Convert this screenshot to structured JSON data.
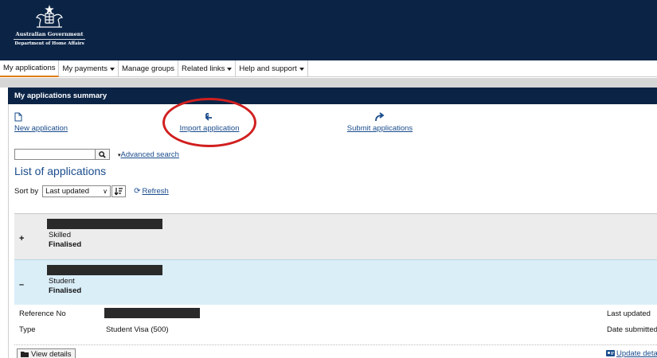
{
  "header": {
    "org_line1": "Australian Government",
    "org_line2": "Department of Home Affairs"
  },
  "nav": {
    "items": [
      {
        "label": "My applications",
        "active": true,
        "dropdown": false
      },
      {
        "label": "My payments",
        "active": false,
        "dropdown": true
      },
      {
        "label": "Manage groups",
        "active": false,
        "dropdown": false
      },
      {
        "label": "Related links",
        "active": false,
        "dropdown": true
      },
      {
        "label": "Help and support",
        "active": false,
        "dropdown": true
      }
    ]
  },
  "summary": {
    "title": "My applications summary",
    "actions": {
      "new": {
        "label": "New application",
        "icon": "document-icon"
      },
      "import": {
        "label": "Import application",
        "icon": "import-arrow-icon"
      },
      "submit": {
        "label": "Submit applications",
        "icon": "share-arrow-icon"
      }
    },
    "highlight_color": "#d11f1f"
  },
  "search": {
    "value": "",
    "button_icon": "search-icon",
    "advanced_label": "Advanced search"
  },
  "list": {
    "title": "List of applications",
    "sort_label": "Sort by",
    "sort_value": "Last updated",
    "refresh_label": "Refresh",
    "applications": [
      {
        "toggle": "+",
        "type": "Skilled",
        "status": "Finalised",
        "expanded": false
      },
      {
        "toggle": "–",
        "type": "Student",
        "status": "Finalised",
        "expanded": true
      }
    ]
  },
  "details": {
    "reference_label": "Reference No",
    "type_label": "Type",
    "type_value": "Student Visa (500)",
    "last_updated_label": "Last updated",
    "date_submitted_label": "Date submitted",
    "view_details_label": "View details",
    "update_details_label": "Update details"
  },
  "colors": {
    "header_bg": "#0b2446",
    "link": "#1a4c8c",
    "active_tab": "#e07a12",
    "expanded_row": "#daeef8"
  }
}
